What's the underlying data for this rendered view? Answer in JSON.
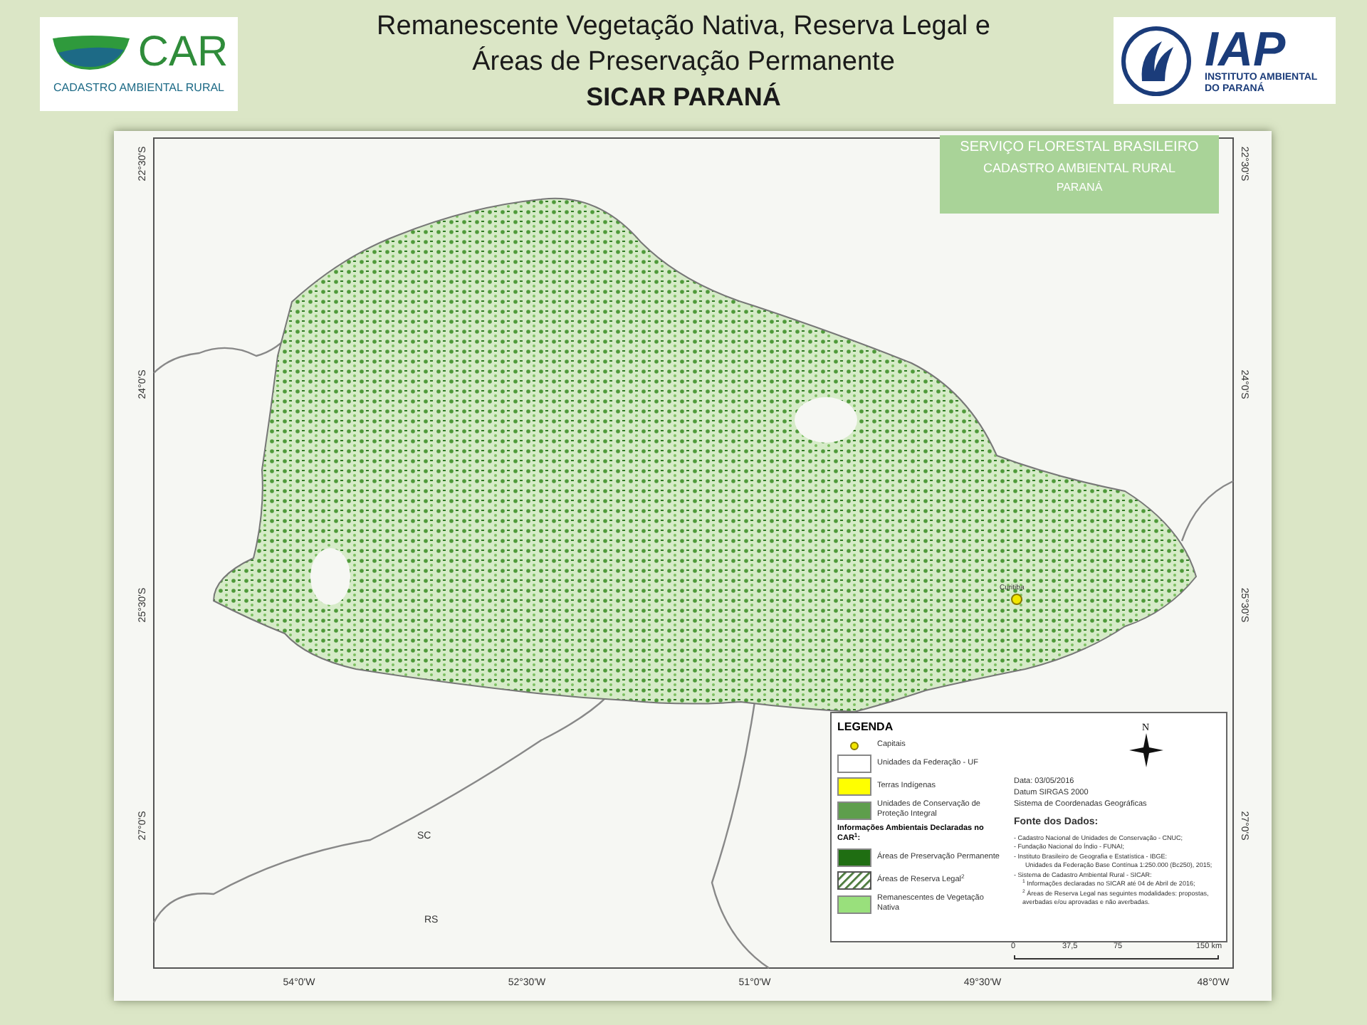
{
  "header": {
    "left_logo": {
      "wordmark": "CAR",
      "tagline": "CADASTRO AMBIENTAL RURAL"
    },
    "title_lines": [
      "Remanescente Vegetação Nativa, Reserva Legal e",
      "Áreas de Preservação Permanente"
    ],
    "subtitle": "SICAR PARANÁ",
    "right_logo": {
      "wordmark": "IAP",
      "tagline_lines": [
        "INSTITUTO AMBIENTAL",
        "DO PARANÁ"
      ]
    }
  },
  "map": {
    "title_box": [
      "SERVIÇO FLORESTAL BRASILEIRO",
      "CADASTRO AMBIENTAL RURAL",
      "PARANÁ"
    ],
    "lat_labels_left": [
      "22°30'S",
      "24°0'S",
      "25°30'S",
      "27°0'S"
    ],
    "lat_labels_right": [
      "22°30'S",
      "24°0'S",
      "25°30'S",
      "27°0'S"
    ],
    "lon_labels": [
      "54°0'W",
      "52°30'W",
      "51°0'W",
      "49°30'W",
      "48°0'W"
    ],
    "places": [
      {
        "text": "Curitiba",
        "kind": "capital"
      },
      {
        "text": "SC",
        "kind": "state"
      },
      {
        "text": "RS",
        "kind": "state"
      }
    ],
    "legend": {
      "title": "LEGENDA",
      "items": [
        {
          "kind": "point",
          "label": "Capitais",
          "color": "#f2e600"
        },
        {
          "kind": "swatch",
          "label": "Unidades da Federação - UF",
          "color": "#ffffff"
        },
        {
          "kind": "swatch",
          "label": "Terras Indígenas",
          "color": "#ffff00"
        },
        {
          "kind": "swatch",
          "label": "Unidades de Conservação de Proteção Integral",
          "color": "#5e9e4c"
        },
        {
          "kind": "heading",
          "label": "Informações Ambientais Declaradas no CAR$^{1}$:"
        },
        {
          "kind": "swatch",
          "label": "Áreas de Preservação Permanente",
          "color": "#1f6e12"
        },
        {
          "kind": "hatch",
          "label": "Áreas de Reserva Legal$^{2}$",
          "color": "#4a7a3a"
        },
        {
          "kind": "swatch",
          "label": "Remanescentes de Vegetação Nativa",
          "color": "#99e07c"
        }
      ],
      "north": "N",
      "info": [
        "Data: 03/05/2016",
        "Datum SIRGAS 2000",
        "Sistema de Coordenadas Geográficas"
      ],
      "sources_title": "Fonte dos Dados:",
      "sources": [
        {
          "kind": "item",
          "text": "- Cadastro Nacional de Unidades de Conservação - CNUC;"
        },
        {
          "kind": "item",
          "text": "- Fundação Nacional do Índio - FUNAI;"
        },
        {
          "kind": "item",
          "text": "- Instituto Brasileiro de Geografia e Estatística - IBGE:"
        },
        {
          "kind": "sub",
          "text": "Unidades da Federação Base Contínua 1:250.000 (Bc250), 2015;"
        },
        {
          "kind": "item",
          "text": "- Sistema de Cadastro Ambiental Rural - SICAR:"
        },
        {
          "kind": "note",
          "text": "$^{1}$ Informações declaradas no SICAR até 04 de Abril de 2016;"
        },
        {
          "kind": "note",
          "text": "$^{2}$ Áreas de Reserva Legal nas seguintes modalidades: propostas, averbadas e/ou aprovadas e não averbadas."
        }
      ]
    },
    "scale_labels": [
      "0",
      "37,5",
      "75",
      "150 km"
    ]
  }
}
